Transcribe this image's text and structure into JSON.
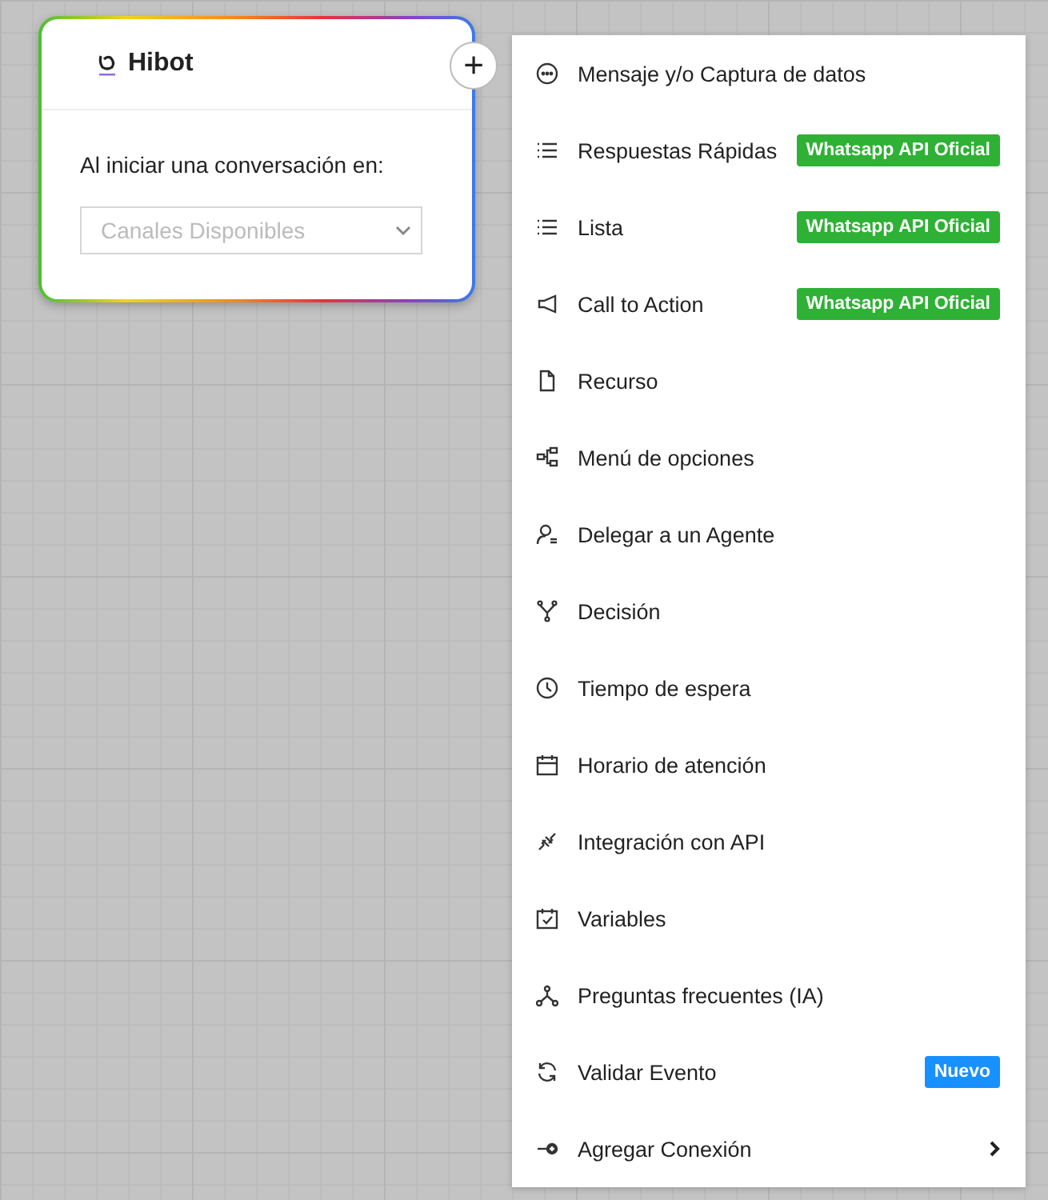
{
  "node": {
    "title": "Hibot",
    "prompt": "Al iniciar una conversación en:",
    "select": {
      "placeholder": "Canales Disponibles"
    },
    "add_button": "+"
  },
  "menu": {
    "items": [
      {
        "label": "Mensaje y/o Captura de datos"
      },
      {
        "label": "Respuestas Rápidas",
        "badge": {
          "text": "Whatsapp API Oficial",
          "color": "#2eb135"
        }
      },
      {
        "label": "Lista",
        "badge": {
          "text": "Whatsapp API Oficial",
          "color": "#2eb135"
        }
      },
      {
        "label": "Call to Action",
        "badge": {
          "text": "Whatsapp API Oficial",
          "color": "#2eb135"
        }
      },
      {
        "label": "Recurso"
      },
      {
        "label": "Menú de opciones"
      },
      {
        "label": "Delegar a un Agente"
      },
      {
        "label": "Decisión"
      },
      {
        "label": "Tiempo de espera"
      },
      {
        "label": "Horario de atención"
      },
      {
        "label": "Integración con API"
      },
      {
        "label": "Variables"
      },
      {
        "label": "Preguntas frecuentes (IA)"
      },
      {
        "label": "Validar Evento",
        "badge": {
          "text": "Nuevo",
          "color": "#1890ff"
        }
      },
      {
        "label": "Agregar Conexión",
        "submenu": true
      }
    ]
  }
}
